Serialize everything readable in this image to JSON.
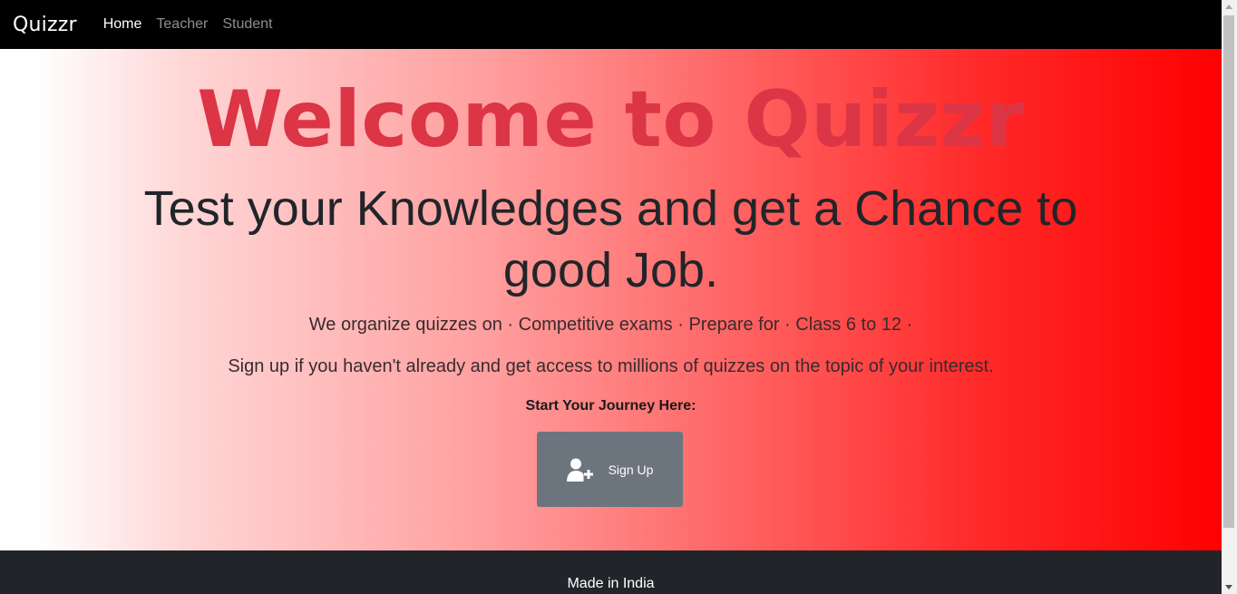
{
  "navbar": {
    "brand": "Quizzr",
    "links": [
      {
        "label": "Home",
        "active": true
      },
      {
        "label": "Teacher",
        "active": false
      },
      {
        "label": "Student",
        "active": false
      }
    ]
  },
  "hero": {
    "title": "Welcome to Quizzr",
    "subtitle": "Test your Knowledges and get a Chance to good Job.",
    "line1": "We organize quizzes on · Competitive exams · Prepare for · Class 6 to 12 ·",
    "line2": "Sign up if you haven't already and get access to millions of quizzes on the topic of your interest.",
    "journey": "Start Your Journey Here:",
    "signup_label": "Sign Up",
    "signup_icon": "user-plus-icon"
  },
  "footer": {
    "text": "Made in India"
  },
  "colors": {
    "title": "#dc3545",
    "navbar": "#000000",
    "button": "#6c757d",
    "footer": "#212529",
    "gradient_end": "#ff0000"
  }
}
